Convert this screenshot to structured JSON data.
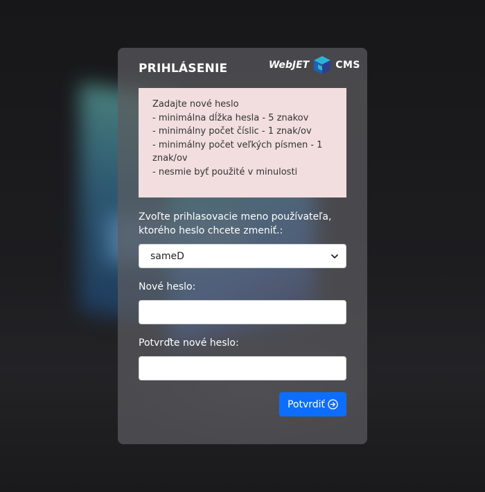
{
  "header": {
    "title": "PRIHLÁSENIE",
    "logo_web": "WebJET",
    "logo_cms": "CMS"
  },
  "info": {
    "lines": [
      "Zadajte nové heslo",
      "- minimálna dĺžka hesla - 5 znakov",
      "- minimálny počet číslic - 1 znak/ov",
      "- minimálny počet veľkých písmen - 1",
      "znak/ov",
      "- nesmie byť použité v minulosti"
    ]
  },
  "form": {
    "user_label_line1": "Zvoľte prihlasovacie meno používateľa,",
    "user_label_line2": "ktorého heslo chcete zmeniť.:",
    "user_selected": "sameD",
    "new_password_label": "Nové heslo:",
    "new_password_value": "",
    "confirm_password_label": "Potvrďte nové heslo:",
    "confirm_password_value": "",
    "submit_label": "Potvrdiť"
  },
  "colors": {
    "button": "#0d6efd",
    "info_bg": "#f2dede"
  },
  "icons": {
    "submit": "arrow-right-circle-icon",
    "select": "chevron-down-icon"
  }
}
